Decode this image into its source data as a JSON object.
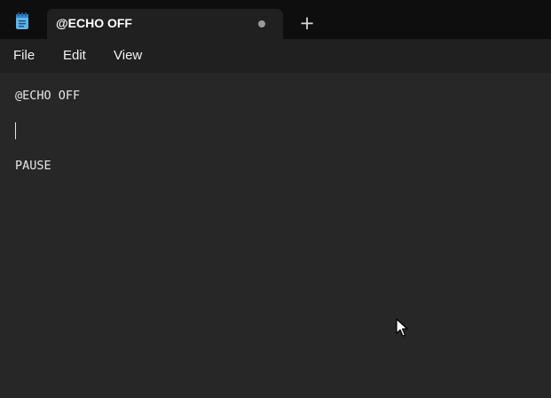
{
  "app": {
    "icon": "notepad-icon"
  },
  "tab": {
    "title": "@ECHO OFF",
    "unsaved_indicator_icon": "unsaved-dot-icon"
  },
  "new_tab": {
    "label": "+",
    "icon": "plus-icon"
  },
  "menu": {
    "items": [
      "File",
      "Edit",
      "View"
    ]
  },
  "editor": {
    "lines": [
      "@ECHO OFF",
      "",
      "PAUSE"
    ],
    "caret_line_index": 1
  },
  "colors": {
    "titlebar_bg": "#0e0e0e",
    "tab_bg": "#202020",
    "menubar_bg": "#202020",
    "editor_bg": "#272727",
    "text": "#e6e6e6"
  }
}
